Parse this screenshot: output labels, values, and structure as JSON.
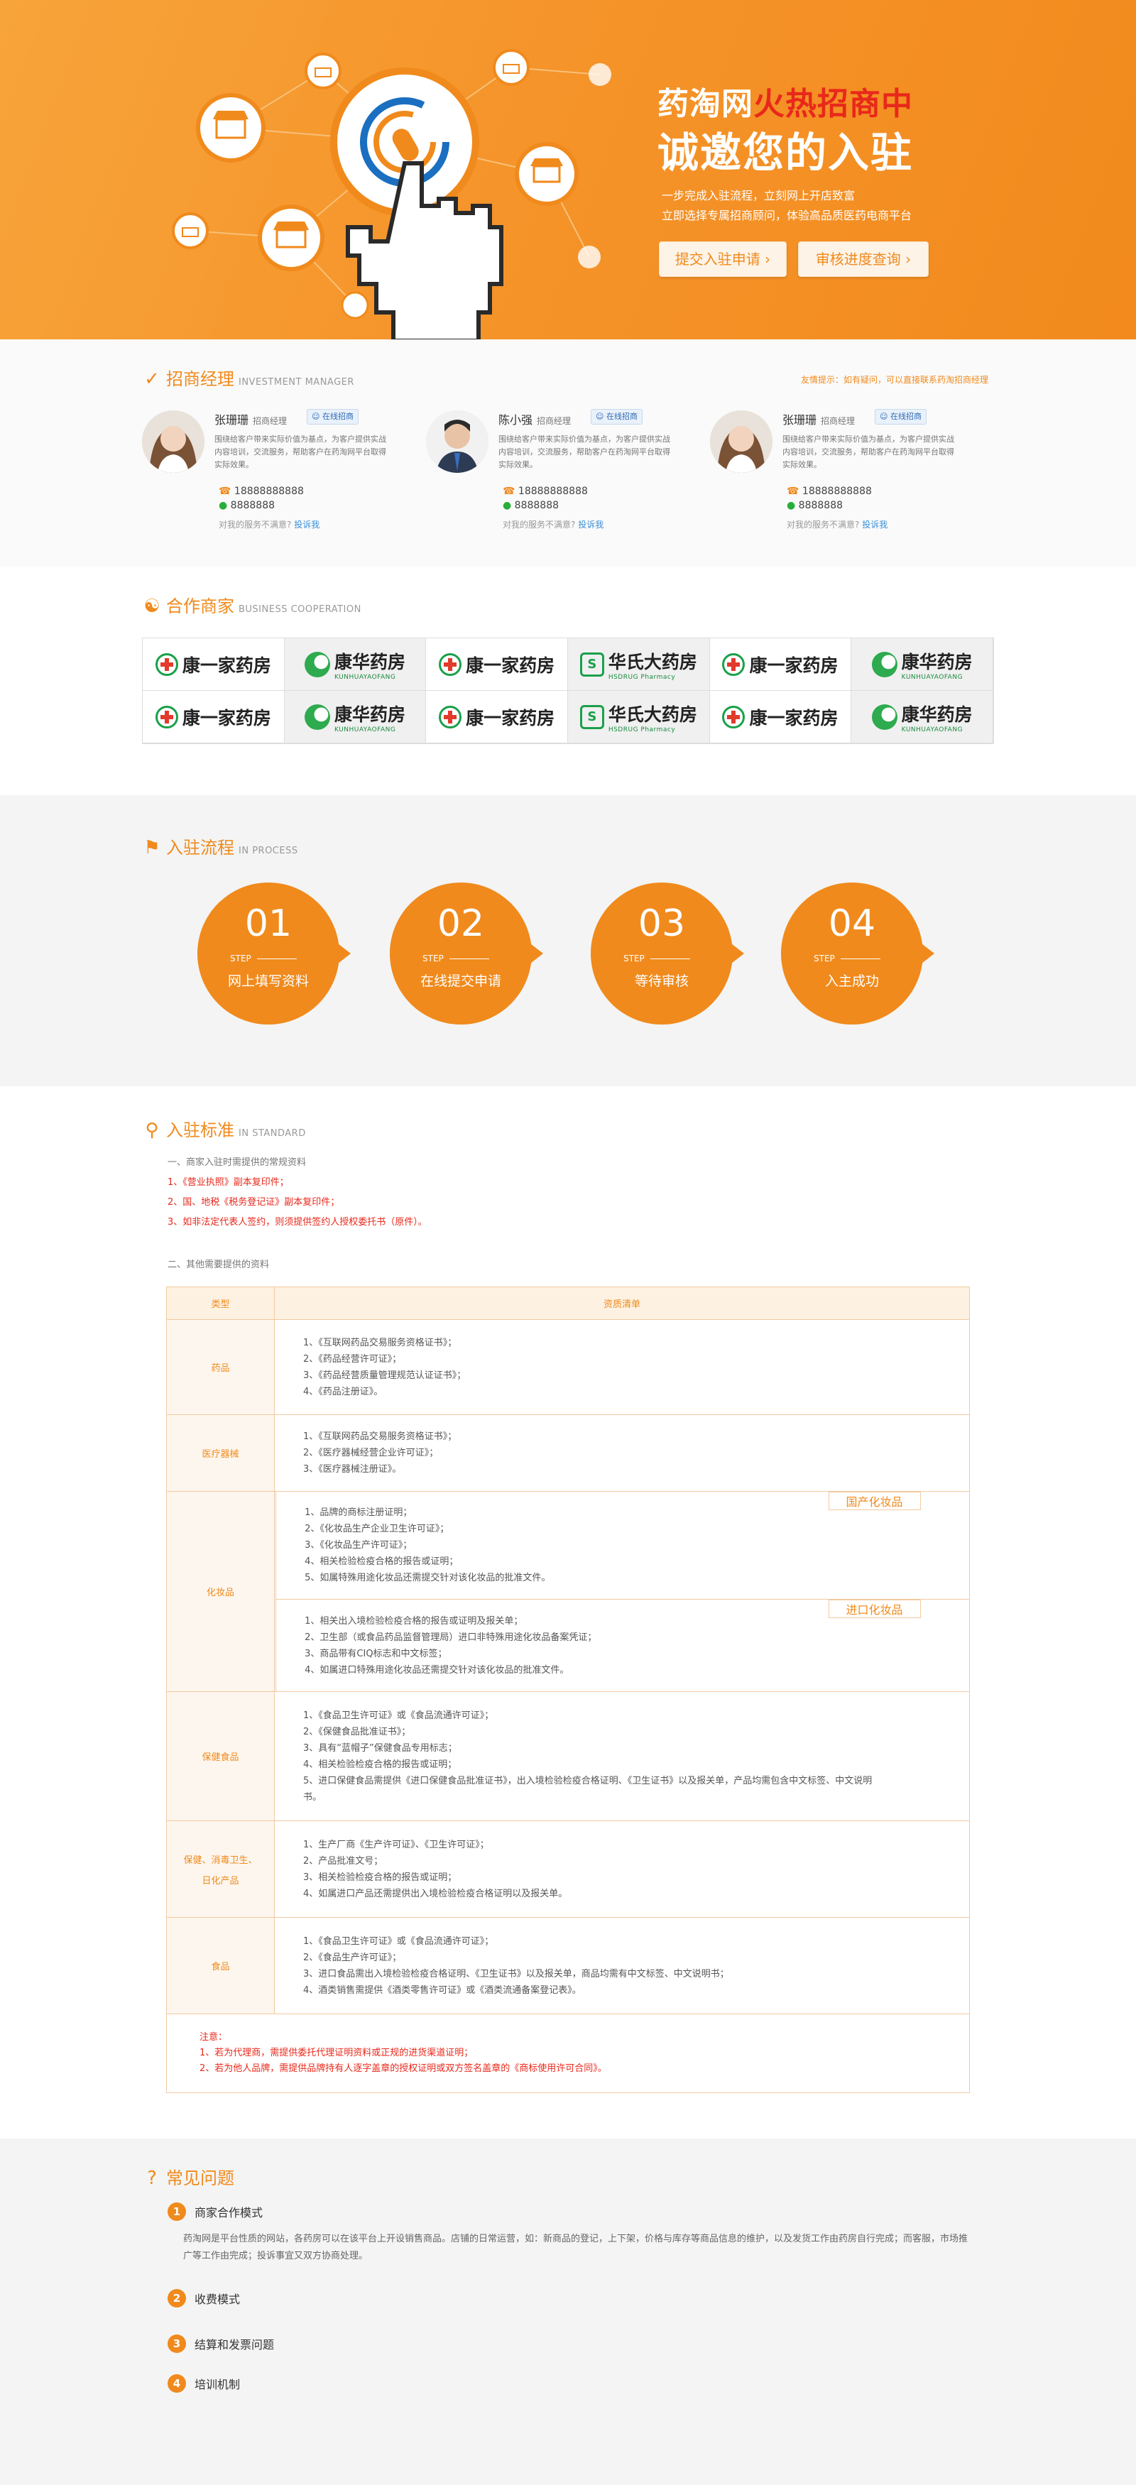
{
  "banner": {
    "headline_prefix": "药淘网",
    "headline_hot": "火热招商中",
    "headline_main": "诚邀您的入驻",
    "line1": "一步完成入驻流程，立刻网上开店致富",
    "line2": "立即选择专属招商顾问，体验高品质医药电商平台",
    "btn_apply": "提交入驻申请",
    "btn_status": "审核进度查询",
    "chevron": "›"
  },
  "managers": {
    "title_cn": "招商经理",
    "title_en": "INVESTMENT MANAGER",
    "tip": "友情提示：如有疑问，可以直接联系药淘招商经理",
    "online_label": "在线招商",
    "list": [
      {
        "name": "张珊珊",
        "title": "招商经理",
        "desc": "围绕给客户带来实际价值为基点，为客户提供实战内容培训，交流服务，帮助客户在药淘网平台取得实际效果。",
        "phone": "18888888888",
        "wechat": "8888888",
        "complain_text": "对我的服务不满意?",
        "complain_link": "投诉我"
      },
      {
        "name": "陈小强",
        "title": "招商经理",
        "desc": "围绕给客户带来实际价值为基点，为客户提供实战内容培训，交流服务，帮助客户在药淘网平台取得实际效果。",
        "phone": "18888888888",
        "wechat": "8888888",
        "complain_text": "对我的服务不满意?",
        "complain_link": "投诉我"
      },
      {
        "name": "张珊珊",
        "title": "招商经理",
        "desc": "围绕给客户带来实际价值为基点，为客户提供实战内容培训，交流服务，帮助客户在药淘网平台取得实际效果。",
        "phone": "18888888888",
        "wechat": "8888888",
        "complain_text": "对我的服务不满意?",
        "complain_link": "投诉我"
      }
    ]
  },
  "partners": {
    "title_cn": "合作商家",
    "title_en": "BUSINESS COOPERATION",
    "names": {
      "kang": "康一家药房",
      "hua": "康华药房",
      "hua_en": "KUNHUAYAOFANG",
      "hs": "华氏大药房",
      "hs_en": "HSDRUG Pharmacy",
      "hs_mark": "S"
    }
  },
  "process": {
    "title_cn": "入驻流程",
    "title_en": "IN PROCESS",
    "step_label": "STEP",
    "steps": [
      {
        "num": "01",
        "name": "网上填写资料"
      },
      {
        "num": "02",
        "name": "在线提交申请"
      },
      {
        "num": "03",
        "name": "等待审核"
      },
      {
        "num": "04",
        "name": "入主成功"
      }
    ]
  },
  "standards": {
    "title_cn": "入驻标准",
    "title_en": "IN STANDARD",
    "intro1": "一、商家入驻时需提供的常规资料",
    "req1": "1、《营业执照》副本复印件；",
    "req2": "2、国、地税《税务登记证》副本复印件；",
    "req3": "3、如非法定代表人签约，则须提供签约人授权委托书（原件）。",
    "intro2": "二、其他需要提供的资料",
    "col_type": "类型",
    "col_list": "资质清单",
    "rows": {
      "yaopin": {
        "type": "药品",
        "items": [
          "1、《互联网药品交易服务资格证书》；",
          "2、《药品经营许可证》；",
          "3、《药品经营质量管理规范认证证书》；",
          "4、《药品注册证》。"
        ]
      },
      "qixie": {
        "type": "医疗器械",
        "items": [
          "1、《互联网药品交易服务资格证书》；",
          "2、《医疗器械经营企业许可证》；",
          "3、《医疗器械注册证》。"
        ]
      },
      "huazhuang": {
        "type": "化妆品",
        "domestic": "国产化妆品",
        "imported": "进口化妆品",
        "d_items": [
          "1、品牌的商标注册证明；",
          "2、《化妆品生产企业卫生许可证》；",
          "3、《化妆品生产许可证》；",
          "4、相关检验检疫合格的报告或证明；",
          "5、如属特殊用途化妆品还需提交针对该化妆品的批准文件。"
        ],
        "i_items": [
          "1、相关出入境检验检疫合格的报告或证明及报关单；",
          "2、卫生部（或食品药品监督管理局）进口非特殊用途化妆品备案凭证；",
          "3、商品带有CIQ标志和中文标签；",
          "4、如属进口特殊用途化妆品还需提交针对该化妆品的批准文件。"
        ]
      },
      "baojian": {
        "type": "保健食品",
        "items": [
          "1、《食品卫生许可证》或《食品流通许可证》；",
          "2、《保健食品批准证书》；",
          "3、具有“蓝帽子”保健食品专用标志；",
          "4、相关检验检疫合格的报告或证明；",
          "5、进口保健食品需提供《进口保健食品批准证书》，出入境检验检疫合格证明、《卫生证书》以及报关单，产品均需包含中文标签、中文说明书。"
        ]
      },
      "riyong": {
        "type_l1": "保健、消毒卫生、",
        "type_l2": "日化产品",
        "items": [
          "1、生产厂商《生产许可证》、《卫生许可证》；",
          "2、产品批准文号；",
          "3、相关检验检疫合格的报告或证明；",
          "4、如属进口产品还需提供出入境检验检疫合格证明以及报关单。"
        ]
      },
      "shipin": {
        "type": "食品",
        "items": [
          "1、《食品卫生许可证》或《食品流通许可证》；",
          "2、《食品生产许可证》；",
          "3、进口食品需出入境检验检疫合格证明、《卫生证书》以及报关单，商品均需有中文标签、中文说明书；",
          "4、酒类销售需提供《酒类零售许可证》或《酒类流通备案登记表》。"
        ]
      }
    },
    "note_title": "注意：",
    "note1": "1、若为代理商，需提供委托代理证明资料或正规的进货渠道证明；",
    "note2": "2、若为他人品牌，需提供品牌持有人逐字盖章的授权证明或双方签名盖章的《商标使用许可合同》。"
  },
  "faq": {
    "title_cn": "常见问题",
    "items": [
      {
        "num": "1",
        "q": "商家合作模式",
        "a": "药淘网是平台性质的网站，各药房可以在该平台上开设销售商品。店铺的日常运营，如：新商品的登记，上下架，价格与库存等商品信息的维护，以及发货工作由药房自行完成；而客服，市场推广等工作由完成；投诉事宜又双方协商处理。"
      },
      {
        "num": "2",
        "q": "收费模式"
      },
      {
        "num": "3",
        "q": "结算和发票问题"
      },
      {
        "num": "4",
        "q": "培训机制"
      }
    ]
  },
  "colors": {
    "accent": "#f08a1c",
    "red": "#e8281b",
    "link": "#3b8fd8"
  }
}
